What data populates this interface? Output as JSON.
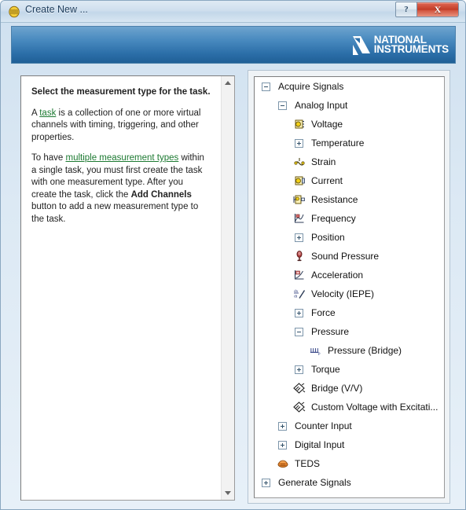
{
  "window": {
    "title": "Create New ...",
    "title_icon": "daq-task-icon",
    "help_button": "?",
    "close_button": "X"
  },
  "banner": {
    "logo_line1": "NATIONAL",
    "logo_line2": "INSTRUMENTS",
    "logo_mark": "ni-eagle-icon",
    "bg_color": "#2b6ea8"
  },
  "help_panel": {
    "heading": "Select the measurement type for the task.",
    "paragraph1": {
      "before_link": "A ",
      "link": "task",
      "after_link": " is a collection of one or more virtual channels with timing, triggering, and other properties."
    },
    "paragraph2": {
      "before_link": "To have ",
      "link": "multiple measurement types",
      "mid": " within a single task, you must first create the task with one measurement type. After you create the task, click the ",
      "bold": "Add Channels",
      "after_bold": " button to add a new measurement type to the task."
    },
    "link_color": "#1d7a32",
    "scroll_up": "scroll-up-arrow",
    "scroll_down": "scroll-down-arrow"
  },
  "tree": {
    "nodes": [
      {
        "label": "Acquire Signals",
        "indent": 0,
        "marker": "minus",
        "icon": ""
      },
      {
        "label": "Analog Input",
        "indent": 1,
        "marker": "minus",
        "icon": ""
      },
      {
        "label": "Voltage",
        "indent": 2,
        "marker": "none",
        "icon": "voltage-icon"
      },
      {
        "label": "Temperature",
        "indent": 2,
        "marker": "plus",
        "icon": ""
      },
      {
        "label": "Strain",
        "indent": 2,
        "marker": "none",
        "icon": "strain-icon"
      },
      {
        "label": "Current",
        "indent": 2,
        "marker": "none",
        "icon": "current-icon"
      },
      {
        "label": "Resistance",
        "indent": 2,
        "marker": "none",
        "icon": "resistance-icon"
      },
      {
        "label": "Frequency",
        "indent": 2,
        "marker": "none",
        "icon": "frequency-icon"
      },
      {
        "label": "Position",
        "indent": 2,
        "marker": "plus",
        "icon": ""
      },
      {
        "label": "Sound Pressure",
        "indent": 2,
        "marker": "none",
        "icon": "microphone-icon"
      },
      {
        "label": "Acceleration",
        "indent": 2,
        "marker": "none",
        "icon": "acceleration-icon"
      },
      {
        "label": "Velocity (IEPE)",
        "indent": 2,
        "marker": "none",
        "icon": "velocity-icon"
      },
      {
        "label": "Force",
        "indent": 2,
        "marker": "plus",
        "icon": ""
      },
      {
        "label": "Pressure",
        "indent": 2,
        "marker": "minus",
        "icon": ""
      },
      {
        "label": "Pressure (Bridge)",
        "indent": 3,
        "marker": "none",
        "icon": "bridge-pressure-icon"
      },
      {
        "label": "Torque",
        "indent": 2,
        "marker": "plus",
        "icon": ""
      },
      {
        "label": "Bridge (V/V)",
        "indent": 2,
        "marker": "none",
        "icon": "bridge-icon"
      },
      {
        "label": "Custom Voltage with Excitati...",
        "indent": 2,
        "marker": "none",
        "icon": "bridge-icon"
      },
      {
        "label": "Counter Input",
        "indent": 1,
        "marker": "plus",
        "icon": ""
      },
      {
        "label": "Digital Input",
        "indent": 1,
        "marker": "plus",
        "icon": ""
      },
      {
        "label": "TEDS",
        "indent": 1,
        "marker": "none",
        "icon": "teds-icon"
      },
      {
        "label": "Generate Signals",
        "indent": 0,
        "marker": "plus",
        "icon": ""
      }
    ]
  }
}
